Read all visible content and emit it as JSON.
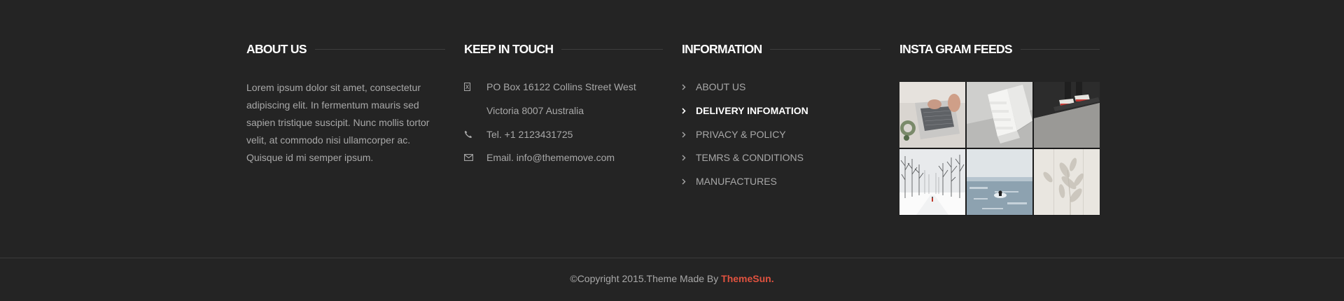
{
  "about": {
    "title": "ABOUT US",
    "text": "Lorem ipsum dolor sit amet, consectetur adipiscing elit. In fermentum mauris sed sapien tristique suscipit. Nunc mollis tortor velit, at commodo nisi ullamcorper ac. Quisque id mi semper ipsum."
  },
  "touch": {
    "title": "KEEP IN TOUCH",
    "address_line1": "PO Box 16122 Collins Street West",
    "address_line2": "Victoria 8007 Australia",
    "phone": "Tel. +1 2123431725",
    "email": "Email. info@thememove.com",
    "icons": [
      "map-marker-icon",
      "phone-icon",
      "envelope-icon"
    ]
  },
  "info": {
    "title": "INFORMATION",
    "items": [
      {
        "label": "ABOUT US"
      },
      {
        "label": "DELIVERY INFOMATION",
        "active": true
      },
      {
        "label": "PRIVACY & POLICY"
      },
      {
        "label": "TEMRS & CONDITIONS"
      },
      {
        "label": "MANUFACTURES"
      }
    ]
  },
  "insta": {
    "title": "INSTA GRAM FEEDS",
    "photos": [
      "laptop-hands",
      "white-stairs",
      "skateboard-feet",
      "snowy-forest",
      "sea-swimmer",
      "leaf-shadow"
    ]
  },
  "footer": {
    "copyright": "©Copyright 2015.Theme Made By ",
    "brand": "ThemeSun."
  },
  "colors": {
    "background": "#242424",
    "heading": "#ffffff",
    "text": "#a8a8a8",
    "brand": "#e0523f"
  }
}
